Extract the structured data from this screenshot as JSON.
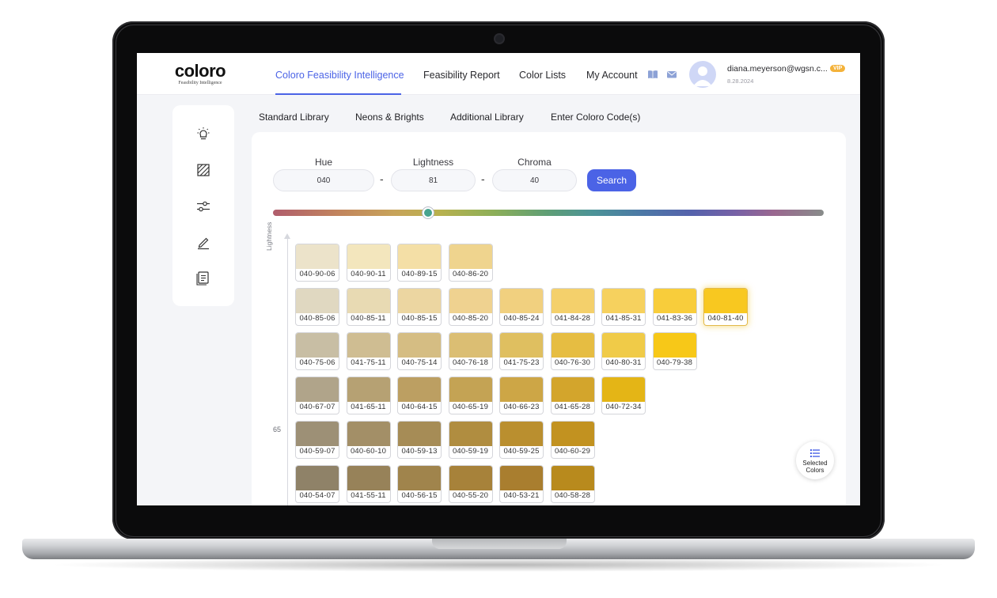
{
  "brand": {
    "name": "coloro",
    "tagline": "Feasibility Intelligence"
  },
  "nav": {
    "items": [
      "Coloro Feasibility Intelligence",
      "Feasibility Report",
      "Color Lists",
      "My Account"
    ],
    "active_index": 0
  },
  "user": {
    "email": "diana.meyerson@wgsn.c...",
    "badge": "VIP",
    "date": "8.28.2024"
  },
  "library_tabs": [
    "Standard Library",
    "Neons & Brights",
    "Additional Library",
    "Enter Coloro Code(s)"
  ],
  "search": {
    "hue_label": "Hue",
    "hue_value": "040",
    "lightness_label": "Lightness",
    "lightness_value": "81",
    "chroma_label": "Chroma",
    "chroma_value": "40",
    "separator": "-",
    "button_label": "Search"
  },
  "hue_slider": {
    "value_fraction": 0.28
  },
  "axis": {
    "label": "Lightness",
    "tick": "65"
  },
  "selected_colors_label": "Selected Colors",
  "selected_code": "040-81-40",
  "grid_rows": [
    [
      {
        "code": "040-90-06",
        "color": "#ece3ca"
      },
      {
        "code": "040-90-11",
        "color": "#f3e6bd"
      },
      {
        "code": "040-89-15",
        "color": "#f4dfa6"
      },
      {
        "code": "040-86-20",
        "color": "#efd48e"
      }
    ],
    [
      {
        "code": "040-85-06",
        "color": "#e0d8c1"
      },
      {
        "code": "040-85-11",
        "color": "#e8dab3"
      },
      {
        "code": "040-85-15",
        "color": "#ecd6a1"
      },
      {
        "code": "040-85-20",
        "color": "#efd290"
      },
      {
        "code": "040-85-24",
        "color": "#f1d07f"
      },
      {
        "code": "041-84-28",
        "color": "#f4d06b"
      },
      {
        "code": "041-85-31",
        "color": "#f6d15e"
      },
      {
        "code": "041-83-36",
        "color": "#f8cd3b"
      },
      {
        "code": "040-81-40",
        "color": "#f8c820"
      }
    ],
    [
      {
        "code": "040-75-06",
        "color": "#c8bea4"
      },
      {
        "code": "041-75-11",
        "color": "#cfbd92"
      },
      {
        "code": "040-75-14",
        "color": "#d5bd83"
      },
      {
        "code": "040-76-18",
        "color": "#dbbe73"
      },
      {
        "code": "041-75-23",
        "color": "#dfbf60"
      },
      {
        "code": "040-76-30",
        "color": "#e6bd42"
      },
      {
        "code": "040-80-31",
        "color": "#f0cb48"
      },
      {
        "code": "040-79-38",
        "color": "#f7c818"
      }
    ],
    [
      {
        "code": "040-67-07",
        "color": "#b0a48a"
      },
      {
        "code": "041-65-11",
        "color": "#b6a173"
      },
      {
        "code": "040-64-15",
        "color": "#bc9f62"
      },
      {
        "code": "040-65-19",
        "color": "#c4a354"
      },
      {
        "code": "040-66-23",
        "color": "#cda646"
      },
      {
        "code": "041-65-28",
        "color": "#d3a52c"
      },
      {
        "code": "040-72-34",
        "color": "#e4b516"
      }
    ],
    [
      {
        "code": "040-59-07",
        "color": "#9d9076"
      },
      {
        "code": "040-60-10",
        "color": "#a38f67"
      },
      {
        "code": "040-59-13",
        "color": "#a68c56"
      },
      {
        "code": "040-59-19",
        "color": "#b08d40"
      },
      {
        "code": "040-59-25",
        "color": "#ba8f2f"
      },
      {
        "code": "040-60-29",
        "color": "#c29220"
      }
    ],
    [
      {
        "code": "040-54-07",
        "color": "#8f8268"
      },
      {
        "code": "041-55-11",
        "color": "#978259"
      },
      {
        "code": "040-56-15",
        "color": "#a0844c"
      },
      {
        "code": "040-55-20",
        "color": "#a7823a"
      },
      {
        "code": "040-53-21",
        "color": "#a97e2f"
      },
      {
        "code": "040-58-28",
        "color": "#b88a1d"
      }
    ]
  ]
}
